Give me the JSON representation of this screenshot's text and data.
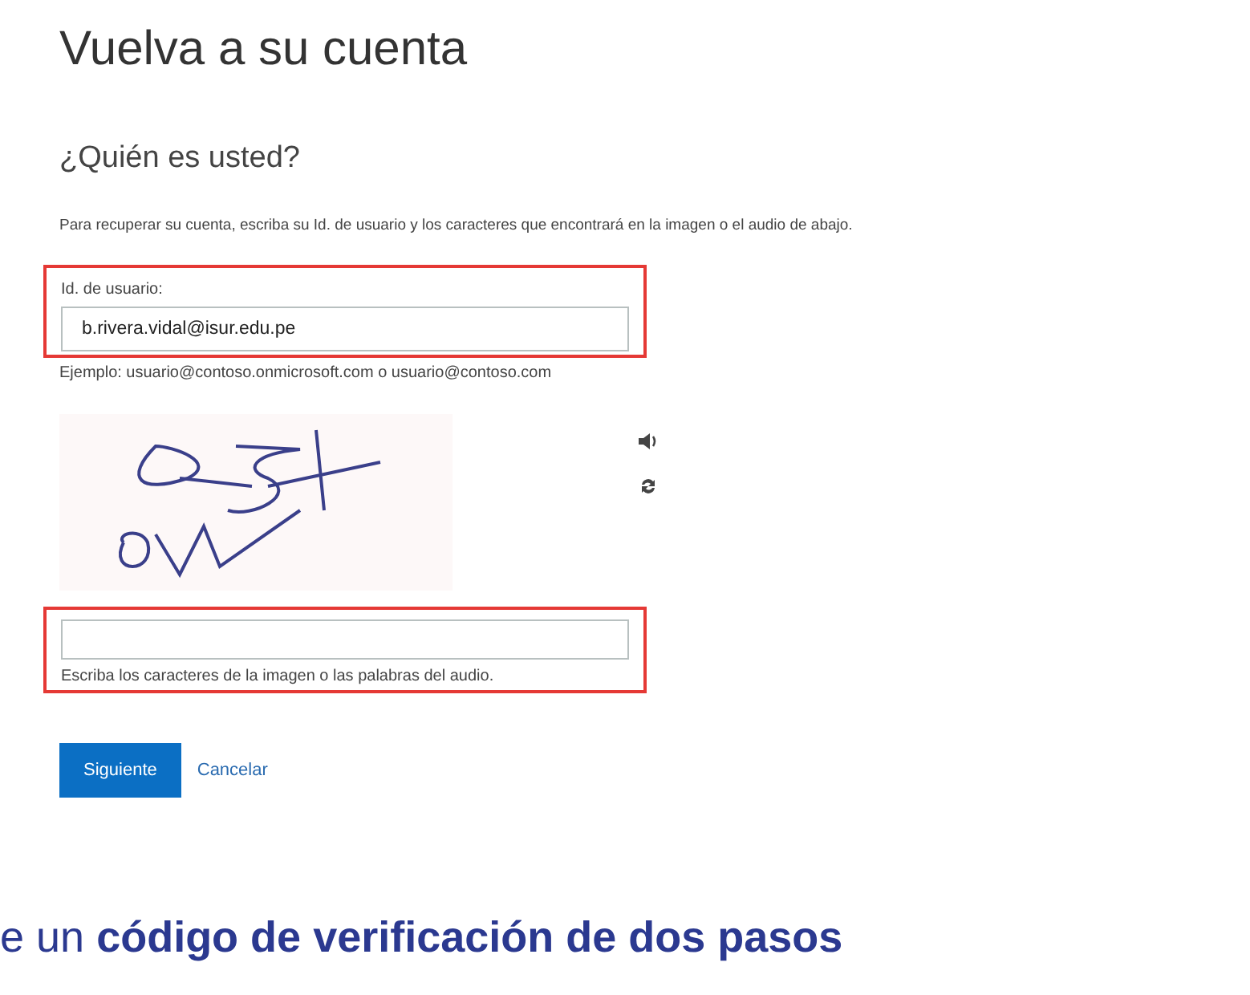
{
  "title": "Vuelva a su cuenta",
  "subtitle": "¿Quién es usted?",
  "instructions": "Para recuperar su cuenta, escriba su Id. de usuario y los caracteres que encontrará en la imagen o el audio de abajo.",
  "user_id": {
    "label": "Id. de usuario:",
    "value": "b.rivera.vidal@isur.edu.pe",
    "highlighted": true
  },
  "example": "Ejemplo: usuario@contoso.onmicrosoft.com o usuario@contoso.com",
  "captcha_input": {
    "hint": "Escriba los caracteres de la imagen o las palabras del audio.",
    "highlighted": true
  },
  "buttons": {
    "next": "Siguiente",
    "cancel": "Cancelar"
  },
  "caption": "e un **código de verificación de dos pasos**"
}
